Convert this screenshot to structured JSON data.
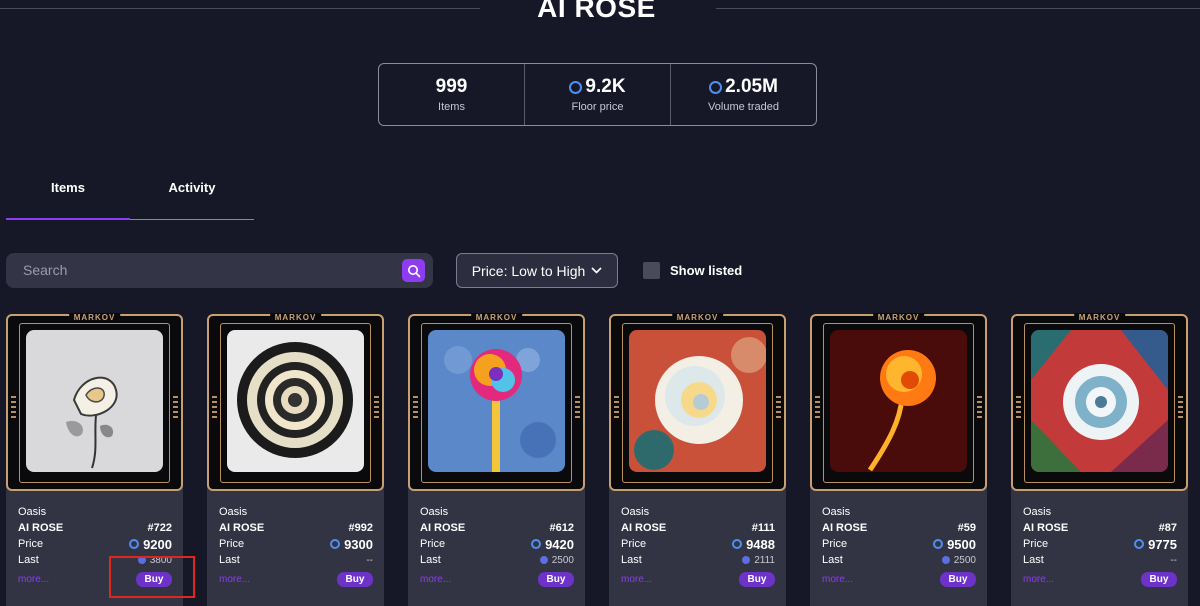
{
  "collection": {
    "title": "AI ROSE"
  },
  "stats": [
    {
      "value": "999",
      "label": "Items",
      "coin": false
    },
    {
      "value": "9.2K",
      "label": "Floor price",
      "coin": true
    },
    {
      "value": "2.05M",
      "label": "Volume traded",
      "coin": true
    }
  ],
  "tabs": {
    "items": "Items",
    "activity": "Activity",
    "active": "Items"
  },
  "search": {
    "placeholder": "Search"
  },
  "sort": {
    "label": "Price: Low to High"
  },
  "filter": {
    "show_listed": "Show listed",
    "checked": false
  },
  "card_labels": {
    "brand": "MARKOV",
    "price": "Price",
    "last": "Last",
    "more": "more...",
    "buy": "Buy"
  },
  "cards": [
    {
      "collection": "Oasis",
      "name": "AI ROSE",
      "id": "#722",
      "price": "9200",
      "last": "3800",
      "art": "sketch"
    },
    {
      "collection": "Oasis",
      "name": "AI ROSE",
      "id": "#992",
      "price": "9300",
      "last": "--",
      "art": "bw"
    },
    {
      "collection": "Oasis",
      "name": "AI ROSE",
      "id": "#612",
      "price": "9420",
      "last": "2500",
      "art": "rainbow"
    },
    {
      "collection": "Oasis",
      "name": "AI ROSE",
      "id": "#111",
      "price": "9488",
      "last": "2111",
      "art": "white"
    },
    {
      "collection": "Oasis",
      "name": "AI ROSE",
      "id": "#59",
      "price": "9500",
      "last": "2500",
      "art": "fire"
    },
    {
      "collection": "Oasis",
      "name": "AI ROSE",
      "id": "#87",
      "price": "9775",
      "last": "--",
      "art": "mosaic"
    }
  ],
  "colors": {
    "accent": "#8b3ef2",
    "buy": "#6d32c8",
    "frame": "#c6a071",
    "coin": "#4e8ff2",
    "background": "#171827"
  }
}
